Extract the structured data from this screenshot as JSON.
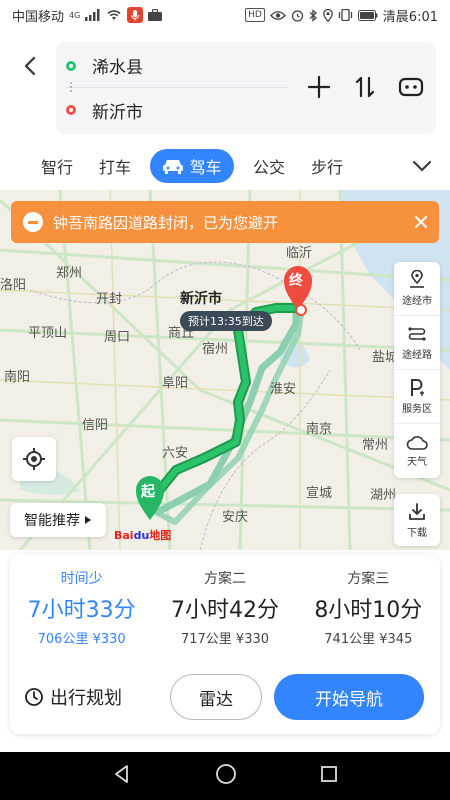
{
  "status_bar": {
    "carrier": "中国移动",
    "network": "4G",
    "time": "清晨6:01",
    "hd": "HD"
  },
  "route": {
    "from": "浠水县",
    "to": "新沂市"
  },
  "modes": [
    {
      "label": "智行"
    },
    {
      "label": "打车"
    },
    {
      "label": "驾车",
      "active": true
    },
    {
      "label": "公交"
    },
    {
      "label": "步行"
    }
  ],
  "alert": {
    "text": "钟吾南路因道路封闭，已为您避开"
  },
  "map": {
    "labels": [
      {
        "text": "临沂"
      },
      {
        "text": "郑州"
      },
      {
        "text": "洛阳"
      },
      {
        "text": "新沂市",
        "strong": true
      },
      {
        "text": "开封"
      },
      {
        "text": "商丘"
      },
      {
        "text": "平顶山"
      },
      {
        "text": "周口"
      },
      {
        "text": "宿州"
      },
      {
        "text": "盐城"
      },
      {
        "text": "南阳"
      },
      {
        "text": "阜阳"
      },
      {
        "text": "淮安"
      },
      {
        "text": "信阳"
      },
      {
        "text": "六安"
      },
      {
        "text": "南京"
      },
      {
        "text": "常州"
      },
      {
        "text": "宣城"
      },
      {
        "text": "湖州"
      },
      {
        "text": "安庆"
      }
    ],
    "eta_badge": "预计13:35到达",
    "start_marker": "起",
    "end_marker": "终",
    "logo": {
      "bai": "Bai",
      "du": "du",
      "suffix": "地图"
    },
    "accent": "#3385ff",
    "route_color": "#2bb35e",
    "alt_route_color": "#8ccfae"
  },
  "tools": [
    {
      "label": "途经市",
      "icon": "pin-route-icon"
    },
    {
      "label": "途经路",
      "icon": "road-icon"
    },
    {
      "label": "服务区",
      "icon": "parking-icon"
    },
    {
      "label": "天气",
      "icon": "cloud-icon"
    }
  ],
  "download_tool": {
    "label": "下载"
  },
  "smart_recommend": "智能推荐",
  "plans": [
    {
      "name": "时间少",
      "time": "7小时33分",
      "distance": "706公里",
      "cost": "¥330",
      "active": true
    },
    {
      "name": "方案二",
      "time": "7小时42分",
      "distance": "717公里",
      "cost": "¥330"
    },
    {
      "name": "方案三",
      "time": "8小时10分",
      "distance": "741公里",
      "cost": "¥345"
    }
  ],
  "actions": {
    "schedule": "出行规划",
    "radar": "雷达",
    "navigate": "开始导航"
  }
}
